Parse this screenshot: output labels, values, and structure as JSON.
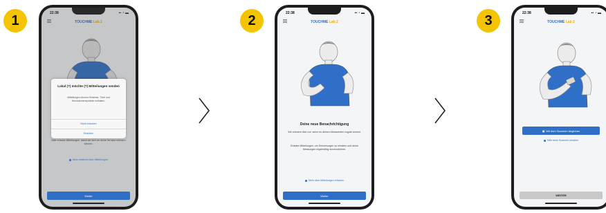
{
  "steps": [
    {
      "number": "1",
      "status_time": "22:38",
      "status_icons": "▪▪ ◔ ▬",
      "logo_main": "TOUCHME",
      "logo_accent": "Lab 2",
      "dialog_title": "Lokal (?) möchte (?) Mitteilungen senden",
      "dialog_body": "Mitteilungen können Hinweise, Töne und Kennzeichensymbole enthalten.",
      "dialog_allow": "Nicht erlauben",
      "dialog_deny": "Erlauben",
      "body_text": "Bitte erlaube Mitteilungen, damit wir dich an deine Termine erinnern können.",
      "link_text": "Mehr erfahren über Mitteilungen",
      "button_label": "Weiter"
    },
    {
      "number": "2",
      "status_time": "22:38",
      "status_icons": "▪▪ ◔ ▬",
      "logo_main": "TOUCHME",
      "logo_accent": "Lab 2",
      "title": "Deine neue Benachrichtigung",
      "body_text_1": "Wir erinnern dich nur, wenn es deinen Messwerten zugute kommt.",
      "body_text_2": "Erlaube Mitteilungen, um Erinnerungen zu erhalten und deine Messungen regelmäßig durchzuführen.",
      "link_text": "Mehr über Mitteilungen erfahren",
      "button_label": "Weiter"
    },
    {
      "number": "3",
      "status_time": "22:38",
      "status_icons": "▪▪ ◔ ▬",
      "logo_main": "TOUCHME",
      "logo_accent": "Lab 2",
      "primary_label": "Mit dem Scannen beginnen",
      "link_text": "Hilfe beim Scannen erhalten",
      "button_label": "WEITER"
    }
  ],
  "colors": {
    "badge": "#f5c400",
    "accent": "#2f6fc7",
    "skin": "#e2e2e2",
    "shirt": "#2f6fc7"
  },
  "icons": {
    "next": "chevron-right-icon",
    "menu": "menu-icon"
  }
}
